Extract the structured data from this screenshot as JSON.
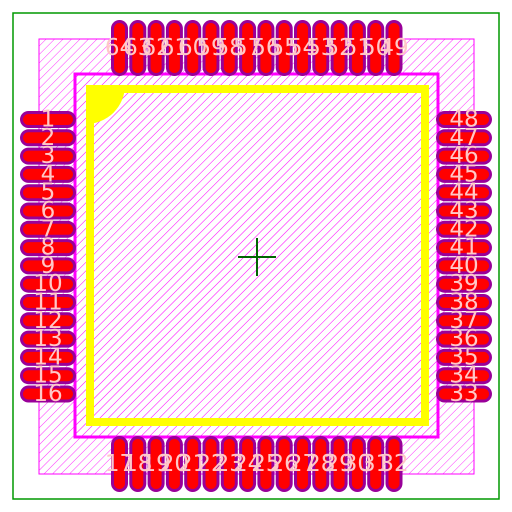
{
  "footprint": {
    "pins_left": [
      "1",
      "2",
      "3",
      "4",
      "5",
      "6",
      "7",
      "8",
      "9",
      "10",
      "11",
      "12",
      "13",
      "14",
      "15",
      "16"
    ],
    "pins_bottom": [
      "17",
      "18",
      "19",
      "20",
      "21",
      "22",
      "23",
      "24",
      "25",
      "26",
      "27",
      "28",
      "29",
      "30",
      "31",
      "32"
    ],
    "pins_right": [
      "33",
      "34",
      "35",
      "36",
      "37",
      "38",
      "39",
      "40",
      "41",
      "42",
      "43",
      "44",
      "45",
      "46",
      "47",
      "48"
    ],
    "pins_top": [
      "49",
      "50",
      "51",
      "52",
      "53",
      "54",
      "55",
      "56",
      "57",
      "58",
      "59",
      "60",
      "61",
      "62",
      "63",
      "64"
    ]
  },
  "colors": {
    "background": "#ffffff",
    "board_outline": "#009900",
    "courtyard_hatch": "#ff00ff",
    "body_outline": "#ff00ff",
    "silkscreen": "#ffff00",
    "pad_outer": "#990099",
    "pad_inner": "#ff0000",
    "pad_label": "#ffc8c8",
    "origin_cross": "#006600"
  },
  "icons": {
    "origin": "crosshair-icon",
    "pin1_marker": "pin-one-marker-icon"
  }
}
